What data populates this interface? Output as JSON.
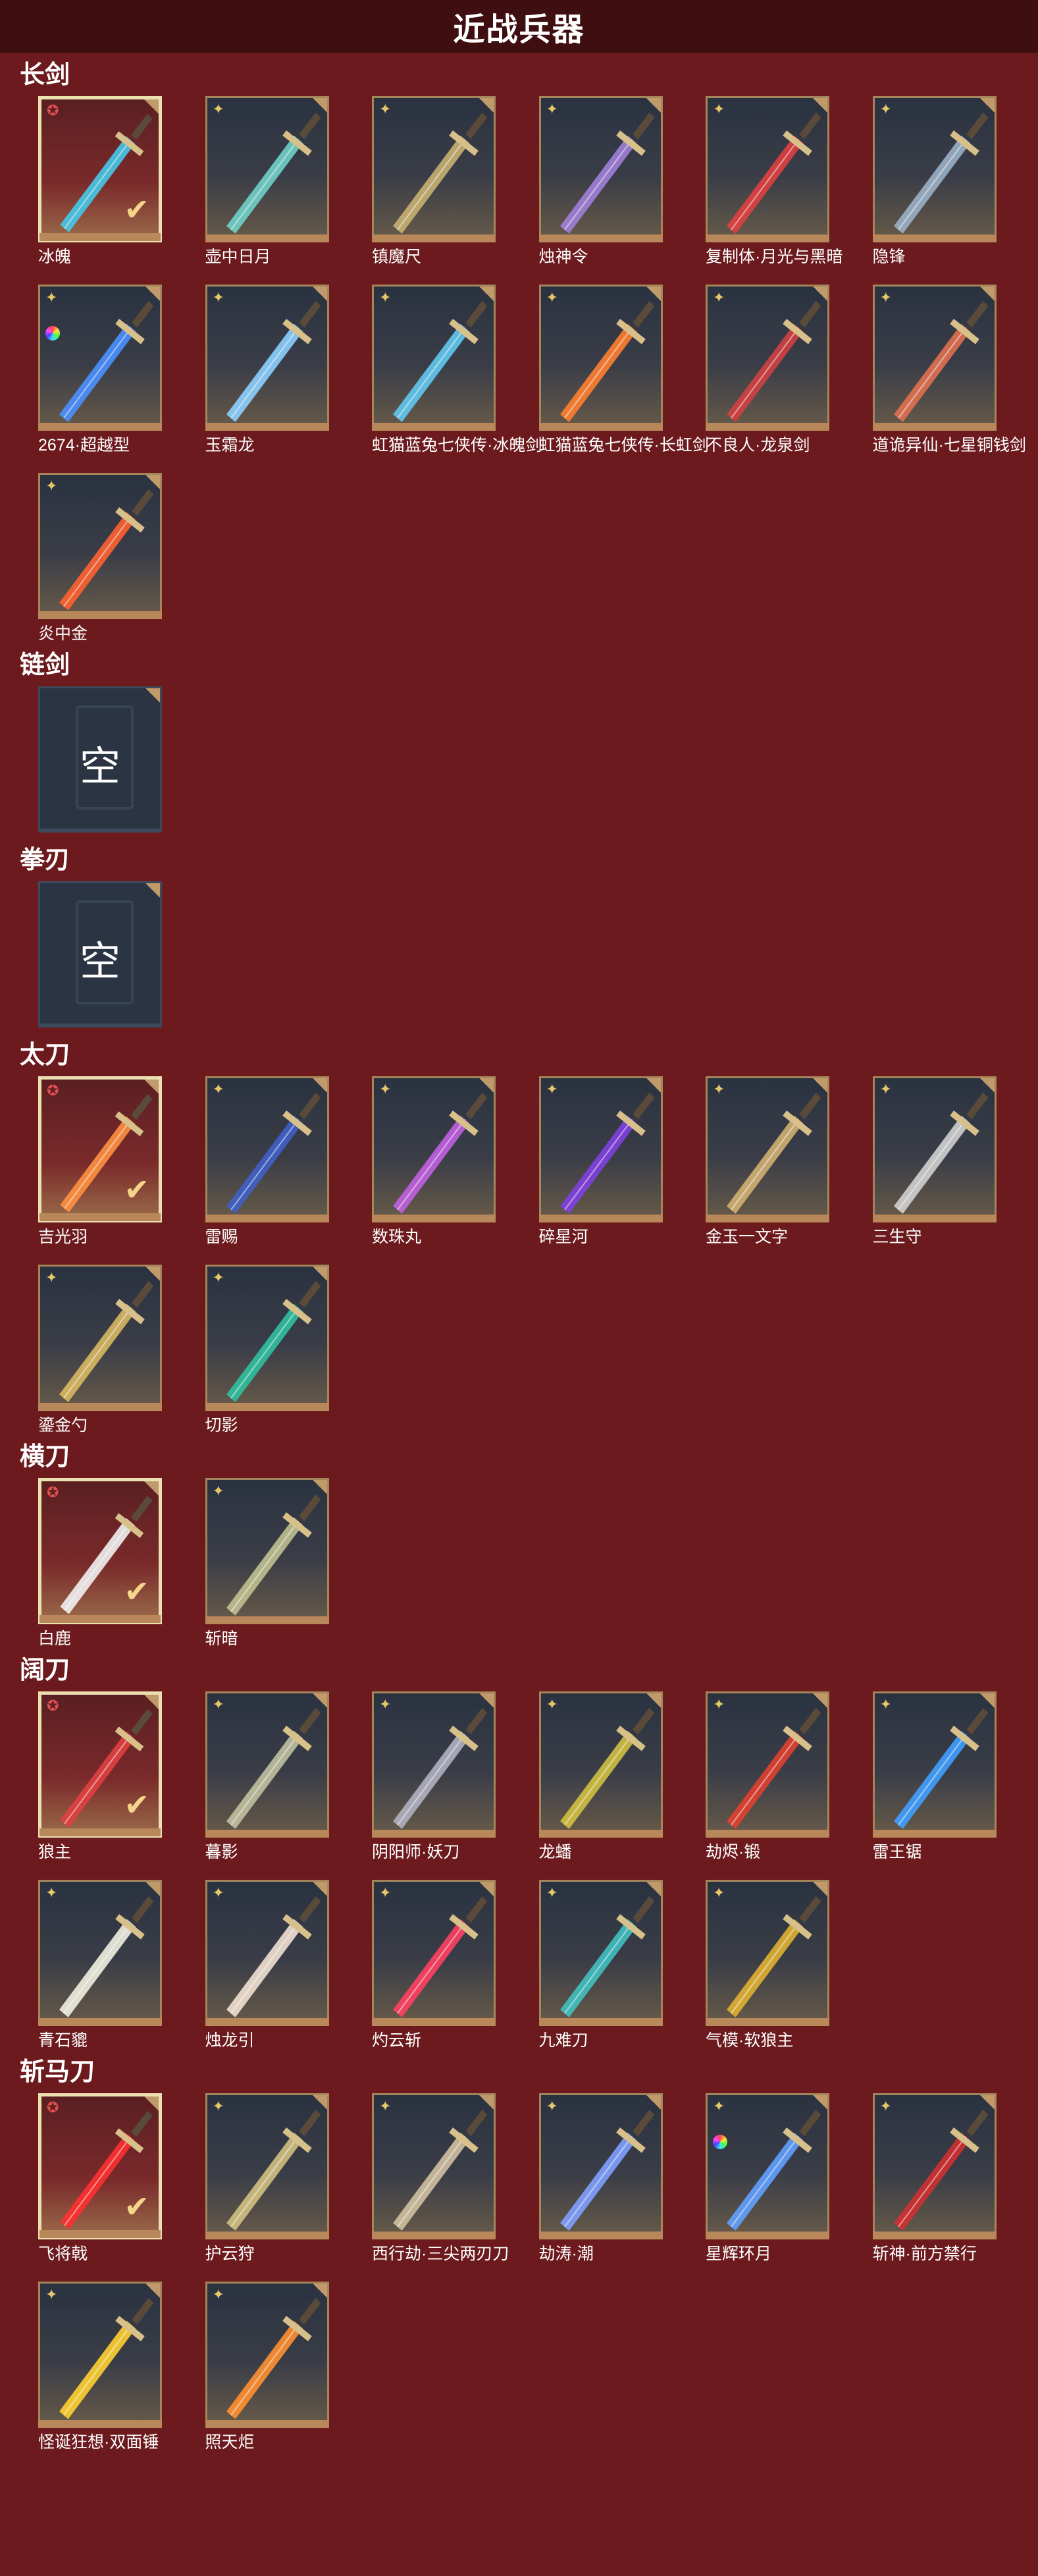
{
  "page_title": "近战兵器",
  "empty_label": "空",
  "sections": [
    {
      "title": "长剑",
      "items": [
        {
          "name": "冰魄",
          "owned": true,
          "badge": "star",
          "color": "#46c8e8"
        },
        {
          "name": "壶中日月",
          "owned": false,
          "badge": "gold",
          "color": "#6fd0c8"
        },
        {
          "name": "镇魔尺",
          "owned": false,
          "badge": "gold",
          "color": "#c8b070"
        },
        {
          "name": "烛神令",
          "owned": false,
          "badge": "gold",
          "color": "#a080d8"
        },
        {
          "name": "复制体·月光与黑暗",
          "owned": false,
          "badge": "gold",
          "color": "#e04040"
        },
        {
          "name": "隐锋",
          "owned": false,
          "badge": "gold",
          "color": "#9ab0c8"
        },
        {
          "name": "2674·超越型",
          "owned": false,
          "badge": "rainbow",
          "color": "#4a90ff"
        },
        {
          "name": "玉霜龙",
          "owned": false,
          "badge": "gold",
          "color": "#8cd0ff"
        },
        {
          "name": "虹猫蓝兔七侠传·冰魄剑",
          "owned": false,
          "badge": "gold",
          "color": "#60c8f0"
        },
        {
          "name": "虹猫蓝兔七侠传·长虹剑",
          "owned": false,
          "badge": "gold",
          "color": "#ff8030"
        },
        {
          "name": "不良人·龙泉剑",
          "owned": false,
          "badge": "gold",
          "color": "#d04040"
        },
        {
          "name": "道诡异仙·七星铜钱剑",
          "owned": false,
          "badge": "gold",
          "color": "#e07050"
        },
        {
          "name": "炎中金",
          "owned": false,
          "badge": "gold",
          "color": "#ff6030"
        }
      ]
    },
    {
      "title": "链剑",
      "items": [
        {
          "name": "",
          "empty": true
        }
      ]
    },
    {
      "title": "拳刃",
      "items": [
        {
          "name": "",
          "empty": true
        }
      ]
    },
    {
      "title": "太刀",
      "items": [
        {
          "name": "吉光羽",
          "owned": true,
          "badge": "star",
          "color": "#ff9040"
        },
        {
          "name": "雷赐",
          "owned": false,
          "badge": "gold",
          "color": "#4060c8"
        },
        {
          "name": "数珠丸",
          "owned": false,
          "badge": "gold",
          "color": "#c060e0"
        },
        {
          "name": "碎星河",
          "owned": false,
          "badge": "gold",
          "color": "#8040e0"
        },
        {
          "name": "金玉一文字",
          "owned": false,
          "badge": "gold",
          "color": "#d0b070"
        },
        {
          "name": "三生守",
          "owned": false,
          "badge": "gold",
          "color": "#d0d0d0"
        },
        {
          "name": "鎏金勺",
          "owned": false,
          "badge": "gold",
          "color": "#d8b860"
        },
        {
          "name": "切影",
          "owned": false,
          "badge": "gold",
          "color": "#30c0a0"
        }
      ]
    },
    {
      "title": "横刀",
      "items": [
        {
          "name": "白鹿",
          "owned": true,
          "badge": "star",
          "color": "#f0f0f0"
        },
        {
          "name": "斩暗",
          "owned": false,
          "badge": "gold",
          "color": "#c0c090"
        }
      ]
    },
    {
      "title": "阔刀",
      "items": [
        {
          "name": "狼主",
          "owned": true,
          "badge": "star",
          "color": "#e04040"
        },
        {
          "name": "暮影",
          "owned": false,
          "badge": "gold",
          "color": "#c0c0a0"
        },
        {
          "name": "阴阳师·妖刀",
          "owned": false,
          "badge": "gold",
          "color": "#b0b0c0"
        },
        {
          "name": "龙蟠",
          "owned": false,
          "badge": "gold",
          "color": "#d0c040"
        },
        {
          "name": "劫烬·锻",
          "owned": false,
          "badge": "gold",
          "color": "#e04030"
        },
        {
          "name": "雷王锯",
          "owned": false,
          "badge": "gold",
          "color": "#40a0ff"
        },
        {
          "name": "青石貔",
          "owned": false,
          "badge": "gold",
          "color": "#f0f0e0"
        },
        {
          "name": "烛龙引",
          "owned": false,
          "badge": "gold",
          "color": "#f0e0d0"
        },
        {
          "name": "灼云斩",
          "owned": false,
          "badge": "gold",
          "color": "#ff4060"
        },
        {
          "name": "九难刀",
          "owned": false,
          "badge": "gold",
          "color": "#40c0c0"
        },
        {
          "name": "气模·软狼主",
          "owned": false,
          "badge": "gold",
          "color": "#e0b030"
        }
      ]
    },
    {
      "title": "斩马刀",
      "items": [
        {
          "name": "飞将戟",
          "owned": true,
          "badge": "star",
          "color": "#ff3030"
        },
        {
          "name": "护云狩",
          "owned": false,
          "badge": "gold",
          "color": "#d0c080"
        },
        {
          "name": "西行劫·三尖两刃刀",
          "owned": false,
          "badge": "gold",
          "color": "#d0c0a0"
        },
        {
          "name": "劫涛·潮",
          "owned": false,
          "badge": "gold",
          "color": "#80a0ff"
        },
        {
          "name": "星辉环月",
          "owned": false,
          "badge": "rainbow",
          "color": "#60a0ff"
        },
        {
          "name": "斩神·前方禁行",
          "owned": false,
          "badge": "gold",
          "color": "#d03030"
        },
        {
          "name": "怪诞狂想·双面锤",
          "owned": false,
          "badge": "gold",
          "color": "#ffd030"
        },
        {
          "name": "照天炬",
          "owned": false,
          "badge": "gold",
          "color": "#ff9030"
        }
      ]
    }
  ]
}
